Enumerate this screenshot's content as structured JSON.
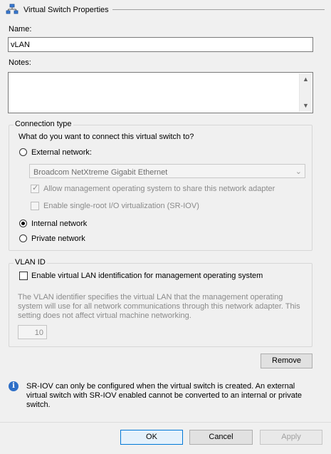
{
  "header": {
    "title": "Virtual Switch Properties",
    "icon": "network-switch-icon"
  },
  "name_field": {
    "label": "Name:",
    "value": "vLAN"
  },
  "notes_field": {
    "label": "Notes:",
    "value": ""
  },
  "connection_type": {
    "legend": "Connection type",
    "question": "What do you want to connect this virtual switch to?",
    "external": {
      "label": "External network:",
      "adapter": "Broadcom NetXtreme Gigabit Ethernet",
      "allow_mgmt_label": "Allow management operating system to share this network adapter",
      "sriov_label": "Enable single-root I/O virtualization (SR-IOV)"
    },
    "internal_label": "Internal network",
    "private_label": "Private network",
    "selected": "Internal network"
  },
  "vlan": {
    "legend": "VLAN ID",
    "enable_label": "Enable virtual LAN identification for management operating system",
    "description": [
      "The VLAN identifier specifies the virtual LAN that the management operating",
      "system will use for all network communications through this network adapter. This",
      "setting does not affect virtual machine networking."
    ],
    "id_value": "10"
  },
  "remove_label": "Remove",
  "info": {
    "lines": [
      "SR-IOV can only be configured when the virtual switch is created. An external",
      "virtual switch with SR-IOV enabled cannot be converted to an internal or private",
      "switch."
    ]
  },
  "footer": {
    "ok_label": "OK",
    "cancel_label": "Cancel",
    "apply_label": "Apply"
  },
  "colors": {
    "accent": "#0078d7",
    "info_blue": "#2e6fc7",
    "disabled_text": "#8a8a8a"
  }
}
